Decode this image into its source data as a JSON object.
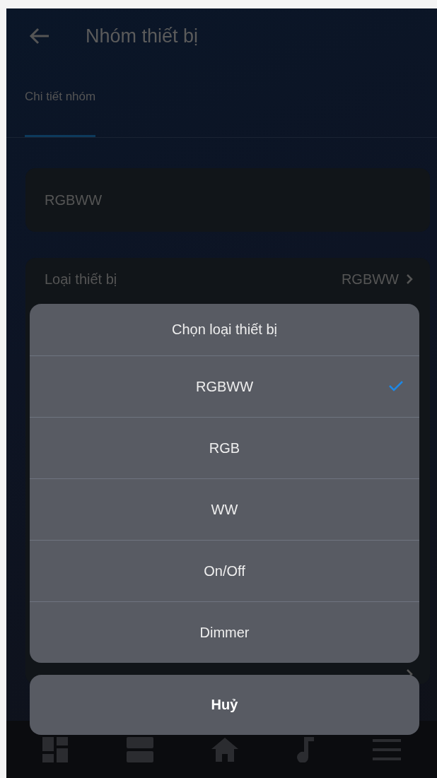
{
  "header": {
    "title": "Nhóm thiết bị"
  },
  "tabs": [
    {
      "label": "Chi tiết nhóm",
      "selected": true
    }
  ],
  "name_field": {
    "value": "RGBWW"
  },
  "settings": [
    {
      "label": "Loại thiết bị",
      "value": "RGBWW"
    }
  ],
  "bottom_nav": [
    {
      "kind": "grid"
    },
    {
      "kind": "rows"
    },
    {
      "kind": "home"
    },
    {
      "kind": "music"
    },
    {
      "kind": "menu"
    }
  ],
  "action_sheet": {
    "title": "Chọn loại thiết bị",
    "options": [
      {
        "label": "RGBWW",
        "selected": true
      },
      {
        "label": "RGB",
        "selected": false
      },
      {
        "label": "WW",
        "selected": false
      },
      {
        "label": "On/Off",
        "selected": false
      },
      {
        "label": "Dimmer",
        "selected": false
      }
    ],
    "cancel": "Huỷ"
  }
}
